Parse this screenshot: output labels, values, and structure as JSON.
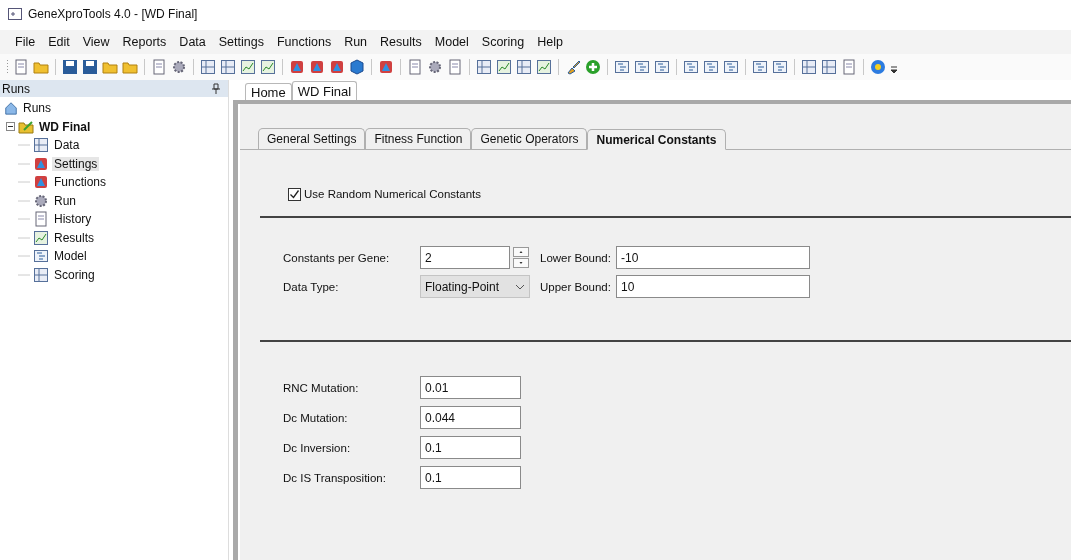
{
  "window": {
    "title": "GeneXproTools 4.0 - [WD Final]"
  },
  "menu": [
    "File",
    "Edit",
    "View",
    "Reports",
    "Data",
    "Settings",
    "Functions",
    "Run",
    "Results",
    "Model",
    "Scoring",
    "Help"
  ],
  "runs_panel": {
    "title": "Runs",
    "tree": [
      {
        "label": "Runs",
        "selected": false,
        "children": [
          {
            "label": "WD Final",
            "expanded": true,
            "selected": false,
            "children": [
              {
                "label": "Data",
                "selected": false
              },
              {
                "label": "Settings",
                "selected": true
              },
              {
                "label": "Functions",
                "selected": false
              },
              {
                "label": "Run",
                "selected": false
              },
              {
                "label": "History",
                "selected": false
              },
              {
                "label": "Results",
                "selected": false
              },
              {
                "label": "Model",
                "selected": false
              },
              {
                "label": "Scoring",
                "selected": false
              }
            ]
          }
        ]
      }
    ]
  },
  "document_tabs": [
    {
      "label": "Home",
      "selected": false
    },
    {
      "label": "WD Final",
      "selected": true
    }
  ],
  "settings_tabs": [
    {
      "label": "General Settings",
      "selected": false
    },
    {
      "label": "Fitness Function",
      "selected": false
    },
    {
      "label": "Genetic Operators",
      "selected": false
    },
    {
      "label": "Numerical Constants",
      "selected": true
    }
  ],
  "use_random_constants": {
    "label": "Use Random Numerical Constants",
    "checked": true
  },
  "constants": {
    "constants_per_gene": {
      "label": "Constants per Gene:",
      "value": "2"
    },
    "data_type": {
      "label": "Data Type:",
      "value": "Floating-Point"
    },
    "lower_bound": {
      "label": "Lower Bound:",
      "value": "-10"
    },
    "upper_bound": {
      "label": "Upper Bound:",
      "value": "10"
    }
  },
  "rates": [
    {
      "label": "RNC Mutation:",
      "value": "0.01"
    },
    {
      "label": "Dc Mutation:",
      "value": "0.044"
    },
    {
      "label": "Dc Inversion:",
      "value": "0.1"
    },
    {
      "label": "Dc IS Transposition:",
      "value": "0.1"
    }
  ]
}
